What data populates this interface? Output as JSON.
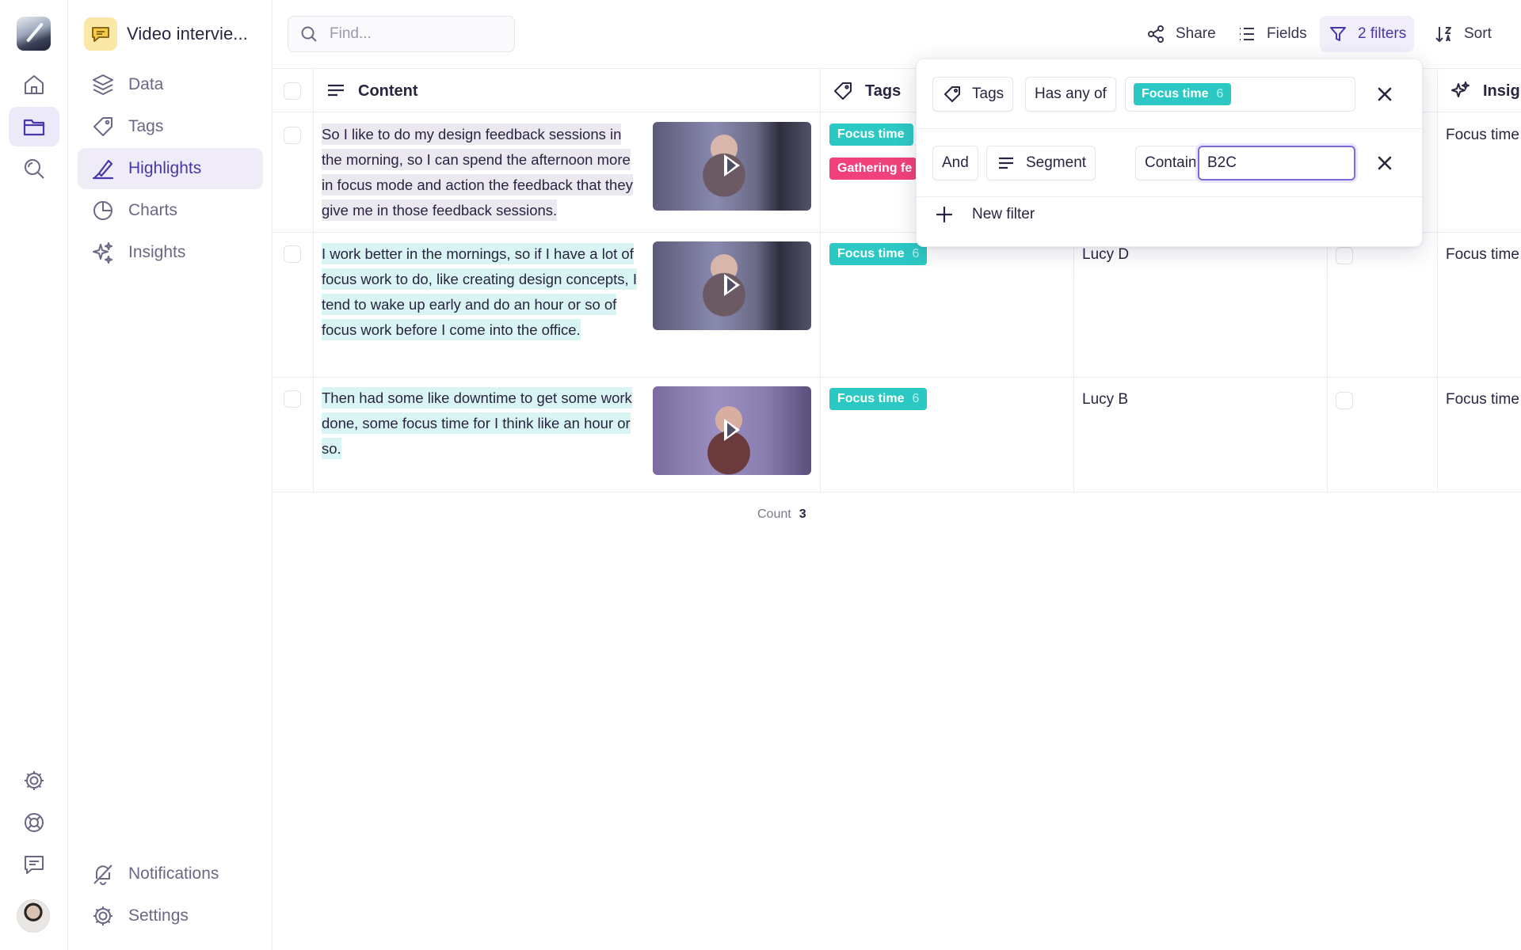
{
  "app": {
    "project_name": "Video intervie..."
  },
  "sidebar": {
    "items": [
      {
        "label": "Data",
        "icon": "layers-icon"
      },
      {
        "label": "Tags",
        "icon": "tag-icon"
      },
      {
        "label": "Highlights",
        "icon": "highlighter-icon",
        "active": true
      },
      {
        "label": "Charts",
        "icon": "pie-chart-icon"
      },
      {
        "label": "Insights",
        "icon": "sparkles-icon"
      }
    ],
    "bottom_items": [
      {
        "label": "Notifications",
        "icon": "bell-off-icon"
      },
      {
        "label": "Settings",
        "icon": "gear-icon"
      }
    ]
  },
  "toolbar": {
    "search_placeholder": "Find...",
    "share_label": "Share",
    "fields_label": "Fields",
    "filters_label": "2 filters",
    "sort_label": "Sort"
  },
  "table": {
    "columns": {
      "content": "Content",
      "tags": "Tags",
      "insights": "Insigh"
    },
    "rows": [
      {
        "content": "So I like to do my design feedback sessions in the morning, so I can spend the afternoon more in focus mode and action the feedback that they give me in those feedback sessions.",
        "tags": [
          {
            "label": "Focus time",
            "count": "",
            "color": "#2cc8c3"
          },
          {
            "label": "Gathering fe",
            "count": "",
            "color": "#f0417a"
          }
        ],
        "participant": "",
        "insight": "Focus time"
      },
      {
        "content": "I work better in the mornings, so if I have a lot of focus work to do, like creating design concepts, I tend to wake up early and do an hour or so of focus work before I come into the office.",
        "tags": [
          {
            "label": "Focus time",
            "count": "6",
            "color": "#2cc8c3"
          }
        ],
        "participant": "Lucy D",
        "insight": "Focus time"
      },
      {
        "content": "Then had some like downtime to get some work done, some focus time for I think like an hour or so.",
        "tags": [
          {
            "label": "Focus time",
            "count": "6",
            "color": "#2cc8c3"
          }
        ],
        "participant": "Lucy B",
        "insight": "Focus time"
      }
    ],
    "footer": {
      "count_label": "Count",
      "count_value": "3"
    }
  },
  "filter_popover": {
    "filters": [
      {
        "field": "Tags",
        "operator": "Has any of",
        "value_tag": {
          "label": "Focus time",
          "count": "6"
        }
      },
      {
        "conjunction": "And",
        "field": "Segment",
        "operator": "Contains",
        "value": "B2C"
      }
    ],
    "new_filter_label": "New filter"
  },
  "colors": {
    "accent": "#4a36a8",
    "tag_teal": "#2cc8c3",
    "tag_pink": "#f0417a",
    "active_bg": "#efecf8"
  }
}
